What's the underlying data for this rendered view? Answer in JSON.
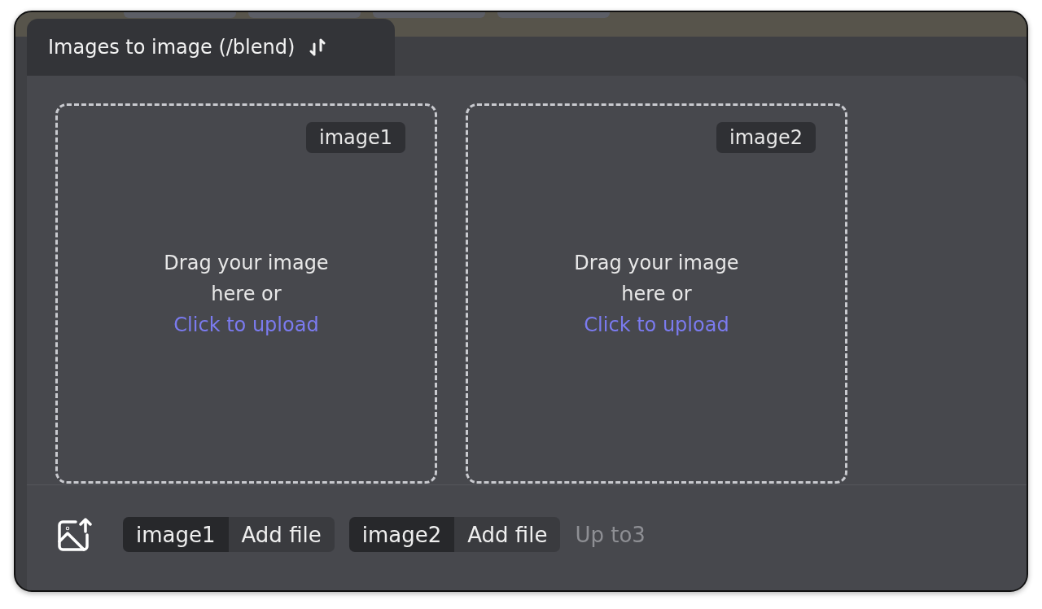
{
  "tab": {
    "title": "Images to image (/blend)"
  },
  "dropzones": [
    {
      "badge": "image1",
      "prompt": "Drag your image here or",
      "link": "Click to upload"
    },
    {
      "badge": "image2",
      "prompt": "Drag your image here or",
      "link": "Click to upload"
    }
  ],
  "footer": {
    "files": [
      {
        "name": "image1",
        "action": "Add file"
      },
      {
        "name": "image2",
        "action": "Add file"
      }
    ],
    "limit": "Up to3"
  }
}
